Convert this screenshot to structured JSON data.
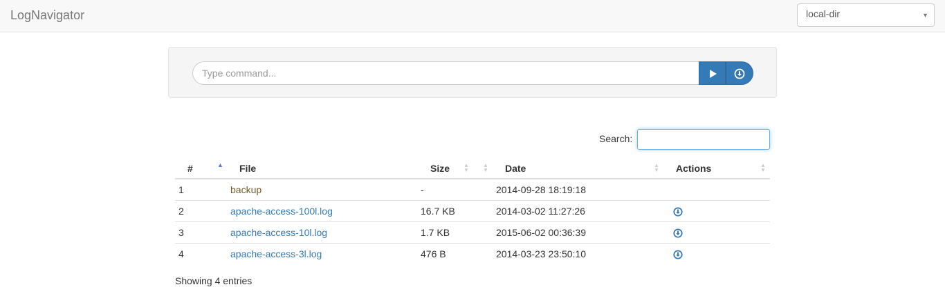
{
  "navbar": {
    "brand": "LogNavigator",
    "directory_select": {
      "value": "local-dir",
      "icon": "caret-down-icon"
    }
  },
  "command_bar": {
    "placeholder": "Type command...",
    "run_icon": "play-icon",
    "download_icon": "download-circle-icon"
  },
  "search": {
    "label": "Search:",
    "value": ""
  },
  "table": {
    "columns": [
      "#",
      "File",
      "Size",
      "Date",
      "Actions"
    ],
    "sorted_column": "#",
    "sort_direction": "ascending",
    "rows": [
      {
        "num": "1",
        "file": "backup",
        "type": "directory",
        "size": "-",
        "date": "2014-09-28 18:19:18",
        "download": false
      },
      {
        "num": "2",
        "file": "apache-access-100l.log",
        "type": "file",
        "size": "16.7 KB",
        "date": "2014-03-02 11:27:26",
        "download": true
      },
      {
        "num": "3",
        "file": "apache-access-10l.log",
        "type": "file",
        "size": "1.7 KB",
        "date": "2015-06-02 00:36:39",
        "download": true
      },
      {
        "num": "4",
        "file": "apache-access-3l.log",
        "type": "file",
        "size": "476 B",
        "date": "2014-03-23 23:50:10",
        "download": true
      }
    ]
  },
  "footer": {
    "entries_text": "Showing 4 entries"
  },
  "colors": {
    "accent": "#337ab7",
    "directory": "#7a5a2a",
    "sort_active": "#6a74c8"
  }
}
